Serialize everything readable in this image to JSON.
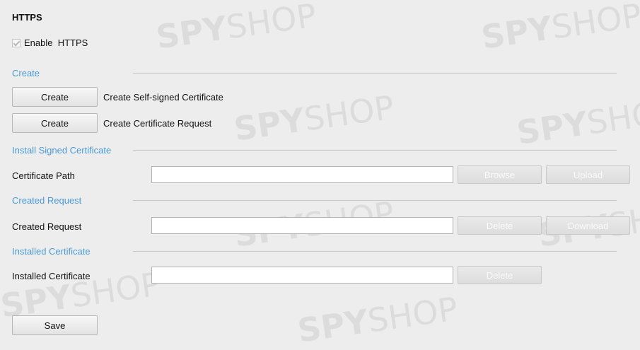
{
  "title": "HTTPS",
  "enable": {
    "label": "Enable  HTTPS",
    "checked": true
  },
  "create": {
    "section_label": "Create",
    "rows": [
      {
        "button": "Create",
        "description": "Create Self-signed Certificate"
      },
      {
        "button": "Create",
        "description": "Create Certificate Request"
      }
    ]
  },
  "install": {
    "section_label": "Install Signed Certificate",
    "path_label": "Certificate Path",
    "path_value": "",
    "browse_label": "Browse",
    "upload_label": "Upload"
  },
  "created_request": {
    "section_label": "Created Request",
    "label": "Created Request",
    "value": "",
    "delete_label": "Delete",
    "download_label": "Download"
  },
  "installed": {
    "section_label": "Installed Certificate",
    "label": "Installed Certificate",
    "value": "",
    "delete_label": "Delete"
  },
  "save_label": "Save",
  "watermark": {
    "brand": "SPY",
    "suffix": "SHOP"
  },
  "colors": {
    "section": "#4a9ad6",
    "background": "#ededed"
  }
}
